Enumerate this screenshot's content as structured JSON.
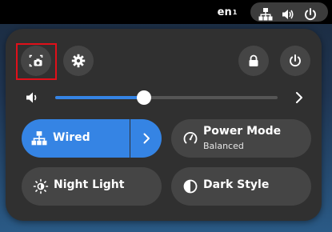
{
  "topbar": {
    "keyboard_layout": "en",
    "keyboard_layout_index": "1",
    "tray_icons": [
      "network-wired-icon",
      "volume-icon",
      "power-icon"
    ]
  },
  "quick_settings": {
    "header_buttons": {
      "screenshot": {
        "icon": "screenshot-icon",
        "highlighted": true
      },
      "settings": {
        "icon": "gear-icon"
      },
      "lock": {
        "icon": "lock-icon"
      },
      "power": {
        "icon": "power-icon"
      }
    },
    "volume": {
      "icon": "volume-icon",
      "level": 0.4
    },
    "toggles": {
      "wired": {
        "label": "Wired",
        "active": true,
        "icon": "network-wired-icon"
      },
      "power_mode": {
        "label": "Power Mode",
        "subtitle": "Balanced",
        "icon": "power-mode-icon"
      },
      "night_light": {
        "label": "Night Light",
        "icon": "night-light-icon"
      },
      "dark_style": {
        "label": "Dark Style",
        "icon": "dark-style-icon"
      }
    }
  },
  "colors": {
    "accent": "#3584e4",
    "panel": "#303030",
    "button": "#454545",
    "highlight": "#e0101a"
  }
}
